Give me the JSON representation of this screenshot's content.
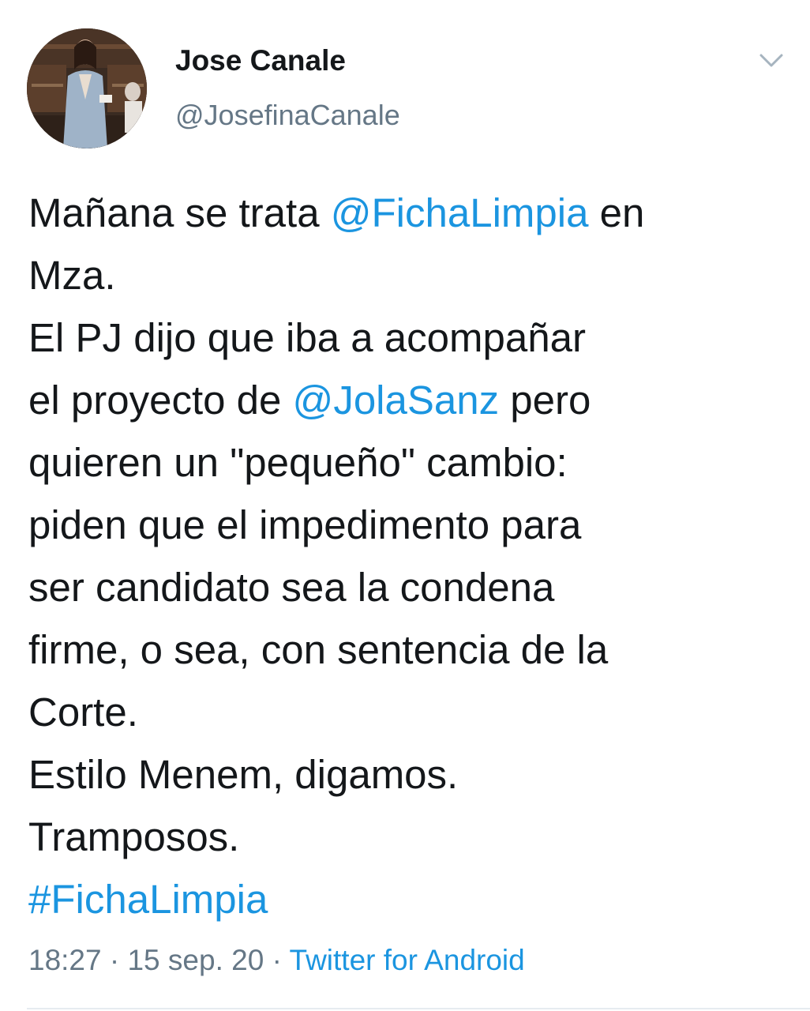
{
  "author": {
    "display_name": "Jose Canale",
    "handle": "@JosefinaCanale"
  },
  "tweet": {
    "lines": [
      [
        "Mañana se trata ",
        "@FichaLimpia",
        " en"
      ],
      "Mza.",
      "El PJ dijo que iba a acompañar",
      [
        "el proyecto de ",
        "@JolaSanz",
        " pero"
      ],
      "quieren un \"pequeño\" cambio:",
      "piden que el impedimento para",
      "ser candidato sea la condena",
      "firme, o sea, con sentencia de la",
      "Corte.",
      "Estilo Menem, digamos.",
      "Tramposos.",
      "#FichaLimpia"
    ]
  },
  "meta": {
    "time": "18:27",
    "separator": "·",
    "date": "15 sep. 20",
    "source": "Twitter for Android"
  },
  "icons": {
    "menu": "chevron-down-icon"
  },
  "colors": {
    "link": "#1b95e0",
    "text": "#14171a",
    "secondary": "#657786"
  }
}
